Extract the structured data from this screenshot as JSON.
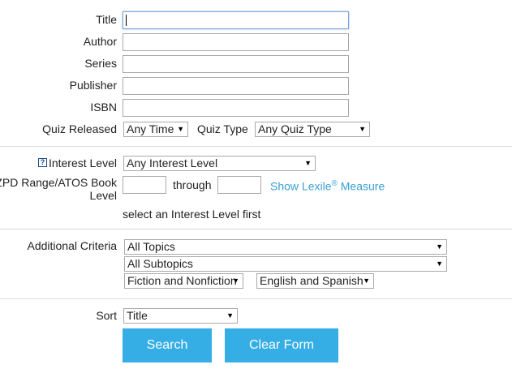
{
  "search_form": {
    "title_label": "Title",
    "author_label": "Author",
    "series_label": "Series",
    "publisher_label": "Publisher",
    "isbn_label": "ISBN",
    "title_value": "",
    "author_value": "",
    "series_value": "",
    "publisher_value": "",
    "isbn_value": "",
    "quiz_released_label": "Quiz Released",
    "quiz_released_value": "Any Time",
    "quiz_type_label": "Quiz Type",
    "quiz_type_value": "Any Quiz Type"
  },
  "level_section": {
    "help_icon": "?",
    "interest_level_label": "Interest Level",
    "interest_level_value": "Any Interest Level",
    "zpd_label": "ZPD Range/ATOS Book Level",
    "zpd_from_value": "",
    "through_label": "through",
    "zpd_to_value": "",
    "lexile_link_text": "Show Lexile",
    "lexile_reg": "®",
    "lexile_measure_text": " Measure",
    "hint_text": "select an Interest Level first"
  },
  "criteria_section": {
    "additional_criteria_label": "Additional Criteria",
    "topics_value": "All Topics",
    "subtopics_value": "All Subtopics",
    "fiction_value": "Fiction and Nonfiction",
    "language_value": "English and Spanish"
  },
  "sort_section": {
    "sort_label": "Sort",
    "sort_value": "Title",
    "search_button": "Search",
    "clear_button": "Clear Form"
  }
}
